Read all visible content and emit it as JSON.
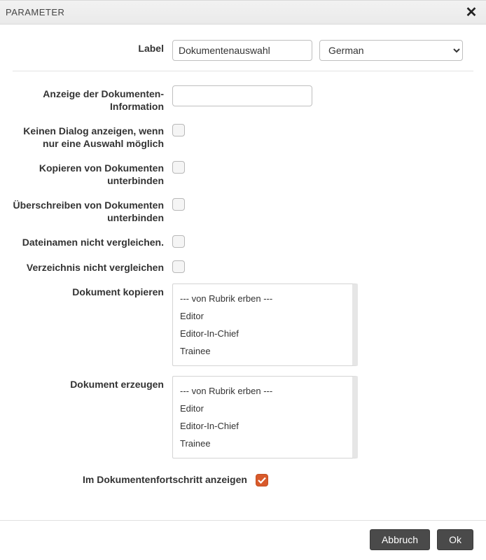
{
  "header": {
    "title": "PARAMETER"
  },
  "labelRow": {
    "label": "Label",
    "value": "Dokumentenauswahl",
    "language": "German"
  },
  "fields": {
    "docInfoDisplay": {
      "label": "Anzeige der Dokumenten-Information",
      "value": ""
    },
    "noDialogSingle": {
      "label": "Keinen Dialog anzeigen, wenn nur eine Auswahl möglich",
      "checked": false
    },
    "preventCopy": {
      "label": "Kopieren von Dokumenten unterbinden",
      "checked": false
    },
    "preventOverwrite": {
      "label": "Überschreiben von Dokumenten unterbinden",
      "checked": false
    },
    "dontCompareFilenames": {
      "label": "Dateinamen nicht vergleichen.",
      "checked": false
    },
    "dontCompareDir": {
      "label": "Verzeichnis nicht vergleichen",
      "checked": false
    },
    "copyDoc": {
      "label": "Dokument kopieren",
      "options": [
        "--- von Rubrik erben ---",
        "Editor",
        "Editor-In-Chief",
        "Trainee"
      ]
    },
    "createDoc": {
      "label": "Dokument erzeugen",
      "options": [
        "--- von Rubrik erben ---",
        "Editor",
        "Editor-In-Chief",
        "Trainee"
      ]
    },
    "showInProgress": {
      "label": "Im Dokumentenfortschritt anzeigen",
      "checked": true
    }
  },
  "footer": {
    "cancel": "Abbruch",
    "ok": "Ok"
  }
}
